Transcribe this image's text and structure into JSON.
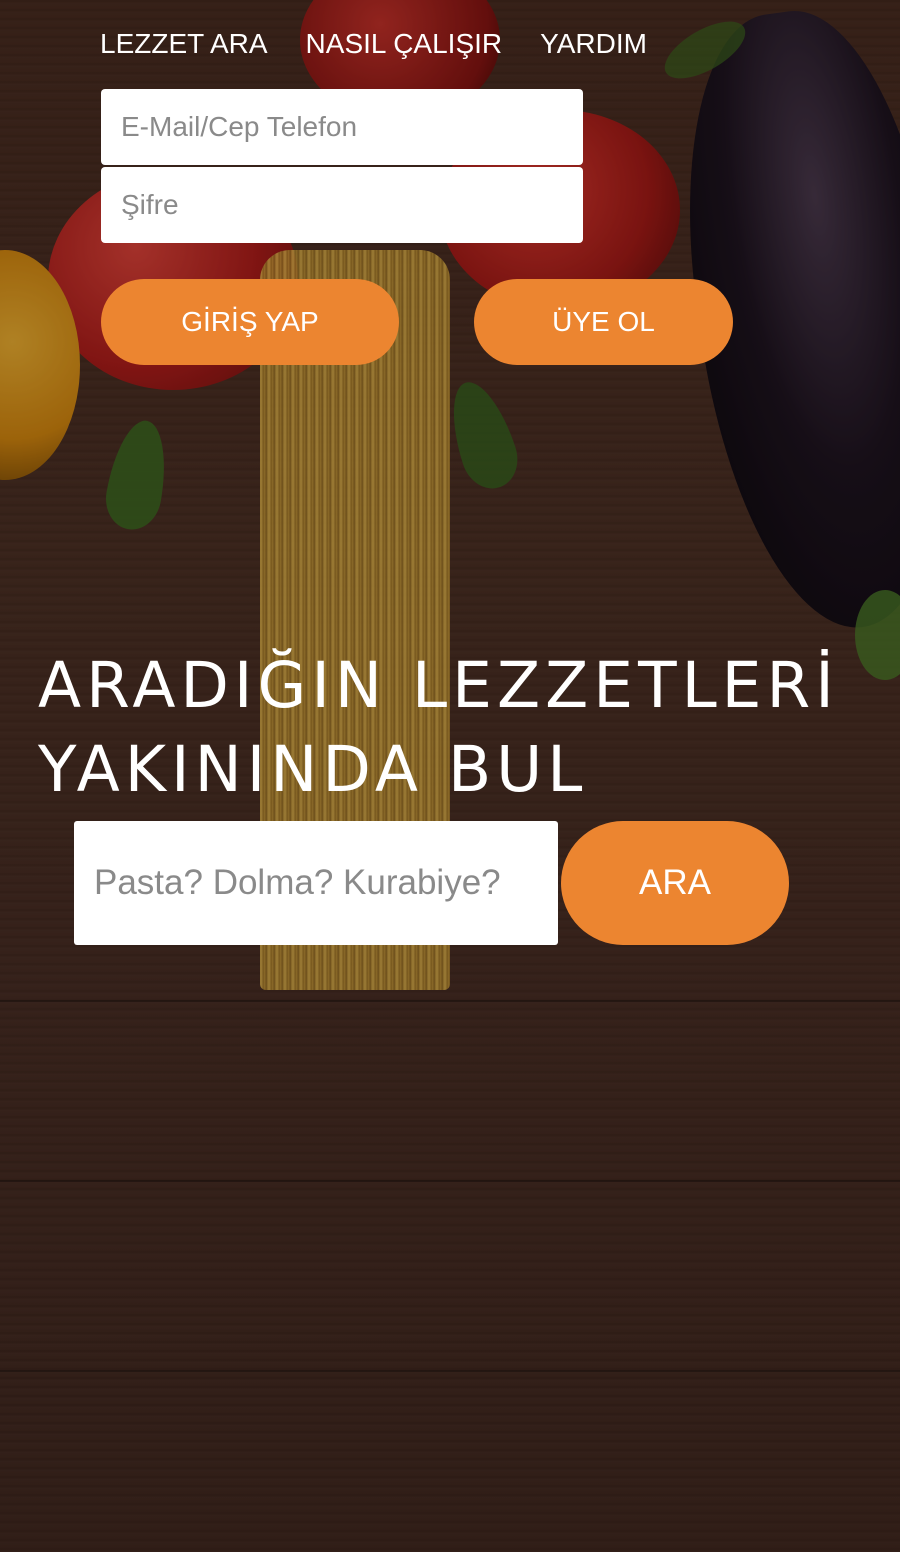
{
  "nav": {
    "items": [
      {
        "label": "LEZZET ARA"
      },
      {
        "label": "NASIL ÇALIŞIR"
      },
      {
        "label": "YARDIM"
      }
    ]
  },
  "login": {
    "email_placeholder": "E-Mail/Cep Telefon",
    "email_value": "",
    "password_placeholder": "Şifre",
    "password_value": "",
    "login_button": "GİRİŞ YAP",
    "signup_button": "ÜYE OL"
  },
  "hero": {
    "headline_line1": "ARADIĞIN LEZZETLERİ",
    "headline_line2": "YAKININDA BUL"
  },
  "search": {
    "placeholder": "Pasta? Dolma? Kurabiye?",
    "value": "",
    "button": "ARA"
  },
  "colors": {
    "accent": "#ec8530",
    "text_on_dark": "#ffffff",
    "input_bg": "#ffffff"
  }
}
